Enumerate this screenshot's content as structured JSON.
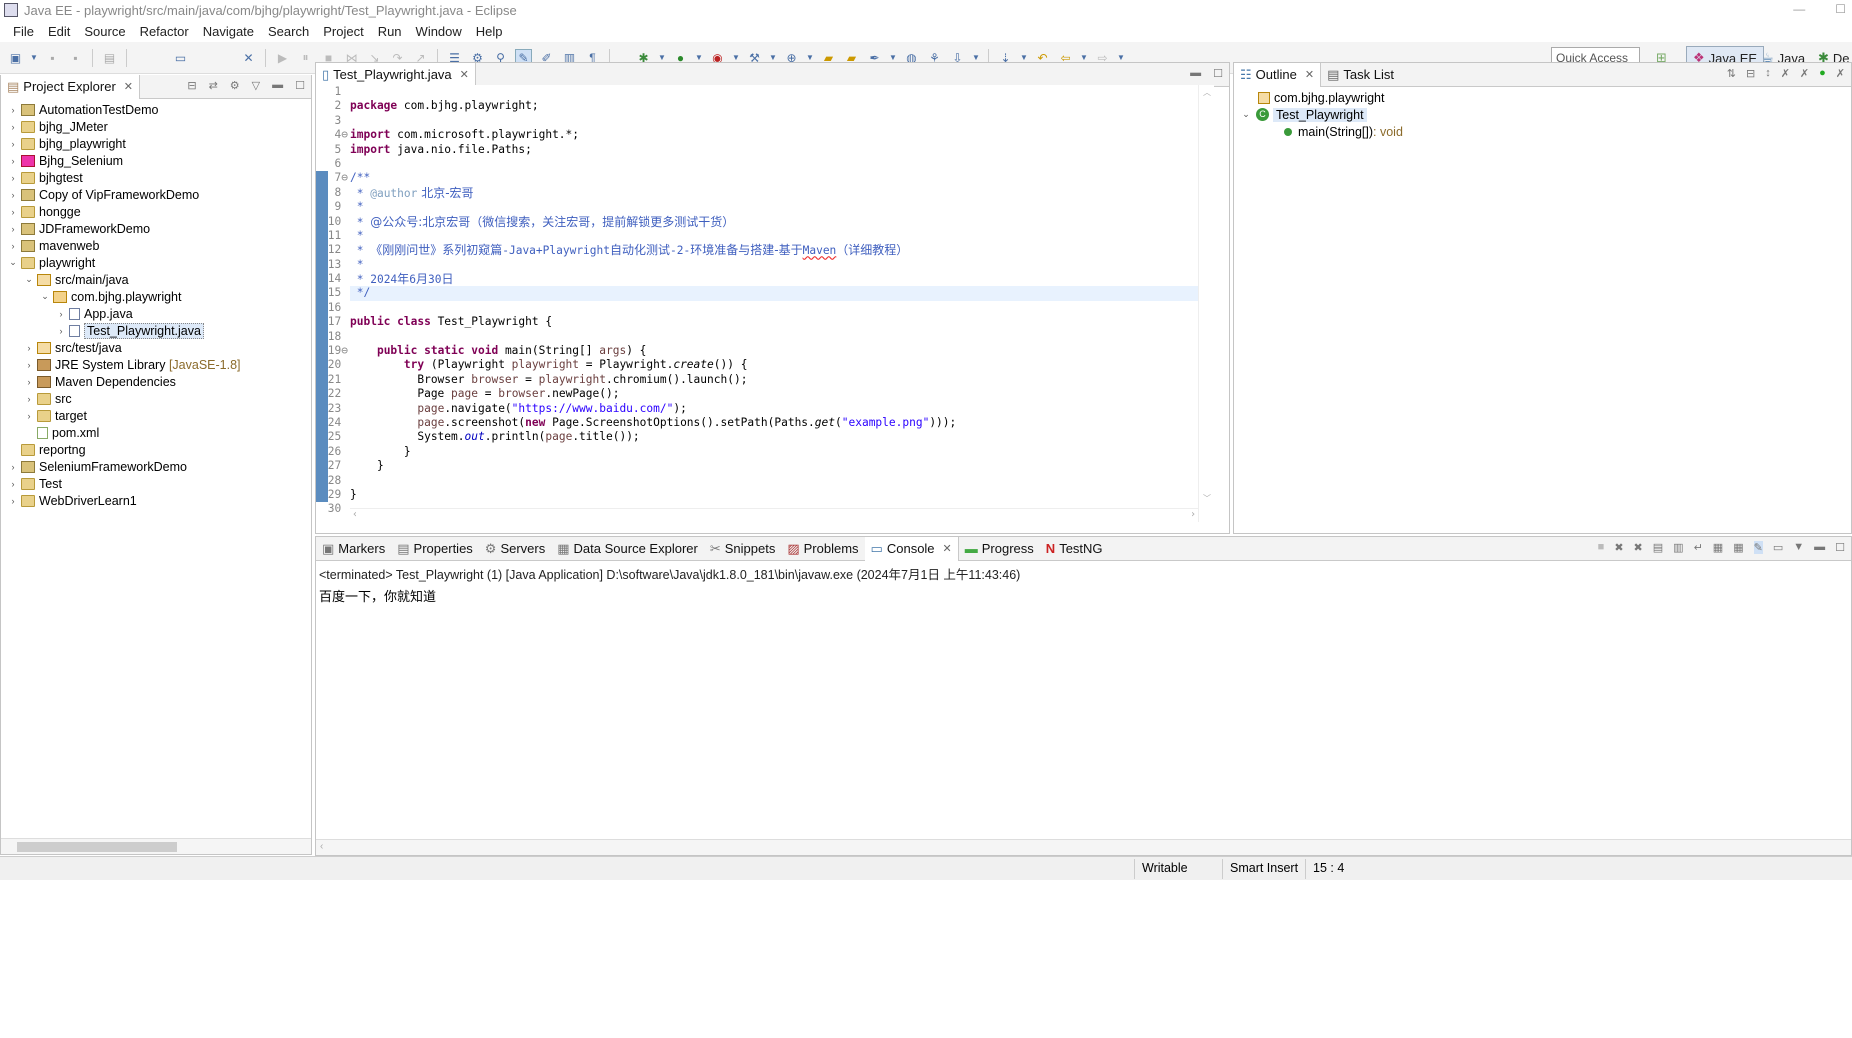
{
  "window": {
    "title": "Java EE - playwright/src/main/java/com/bjhg/playwright/Test_Playwright.java - Eclipse"
  },
  "menu": [
    "File",
    "Edit",
    "Source",
    "Refactor",
    "Navigate",
    "Search",
    "Project",
    "Run",
    "Window",
    "Help"
  ],
  "quick_access": "Quick Access",
  "perspectives": {
    "java_ee": "Java EE",
    "java": "Java",
    "de": "De"
  },
  "project_explorer": {
    "tab": "Project Explorer",
    "items": [
      {
        "label": "AutomationTestDemo"
      },
      {
        "label": "bjhg_JMeter"
      },
      {
        "label": "bjhg_playwright"
      },
      {
        "label": "Bjhg_Selenium"
      },
      {
        "label": "bjhgtest"
      },
      {
        "label": "Copy of VipFrameworkDemo"
      },
      {
        "label": "hongge"
      },
      {
        "label": "JDFrameworkDemo"
      },
      {
        "label": "mavenweb"
      },
      {
        "label": "playwright"
      },
      {
        "label": "src/main/java"
      },
      {
        "label": "com.bjhg.playwright"
      },
      {
        "label": "App.java"
      },
      {
        "label": "Test_Playwright.java"
      },
      {
        "label": "src/test/java"
      },
      {
        "label": "JRE System Library",
        "decoration": "[JavaSE-1.8]"
      },
      {
        "label": "Maven Dependencies"
      },
      {
        "label": "src"
      },
      {
        "label": "target"
      },
      {
        "label": "pom.xml"
      },
      {
        "label": "reportng"
      },
      {
        "label": "SeleniumFrameworkDemo"
      },
      {
        "label": "Test"
      },
      {
        "label": "WebDriverLearn1"
      }
    ]
  },
  "editor": {
    "tab": "Test_Playwright.java",
    "line_numbers": [
      "1",
      "2",
      "3",
      "4",
      "5",
      "6",
      "7",
      "8",
      "9",
      "10",
      "11",
      "12",
      "13",
      "14",
      "15",
      "16",
      "17",
      "18",
      "19",
      "20",
      "21",
      "22",
      "23",
      "24",
      "25",
      "26",
      "27",
      "28",
      "29",
      "30"
    ],
    "comment": {
      "author_tag": "@author",
      "author": " 北京-宏哥",
      "gzh": "@公众号:北京宏哥（微信搜索，关注宏哥，提前解锁更多测试干货）",
      "series_a": "《刚刚问世》系列初窥篇",
      "series_b": "-Java+Playwright",
      "series_c": "自动化测试",
      "series_d": "-2-",
      "series_e": "环境准备与搭建",
      "series_f": "-基于",
      "series_g": "Maven",
      "series_h": "（详细教程）",
      "date_a": "2024",
      "date_b": "年",
      "date_c": "6",
      "date_d": "月",
      "date_e": "30",
      "date_f": "日"
    }
  },
  "outline": {
    "tab": "Outline",
    "task_tab": "Task List",
    "package": "com.bjhg.playwright",
    "class": "Test_Playwright",
    "method": "main(String[])",
    "method_type": " : void"
  },
  "bottom_tabs": [
    "Markers",
    "Properties",
    "Servers",
    "Data Source Explorer",
    "Snippets",
    "Problems",
    "Console",
    "Progress",
    "TestNG"
  ],
  "console": {
    "header": "<terminated> Test_Playwright (1) [Java Application] D:\\software\\Java\\jdk1.8.0_181\\bin\\javaw.exe (2024年7月1日 上午11:43:46)",
    "output": "百度一下，你就知道"
  },
  "status_bar": {
    "writable": "Writable",
    "insert": "Smart Insert",
    "position": "15 : 4"
  }
}
